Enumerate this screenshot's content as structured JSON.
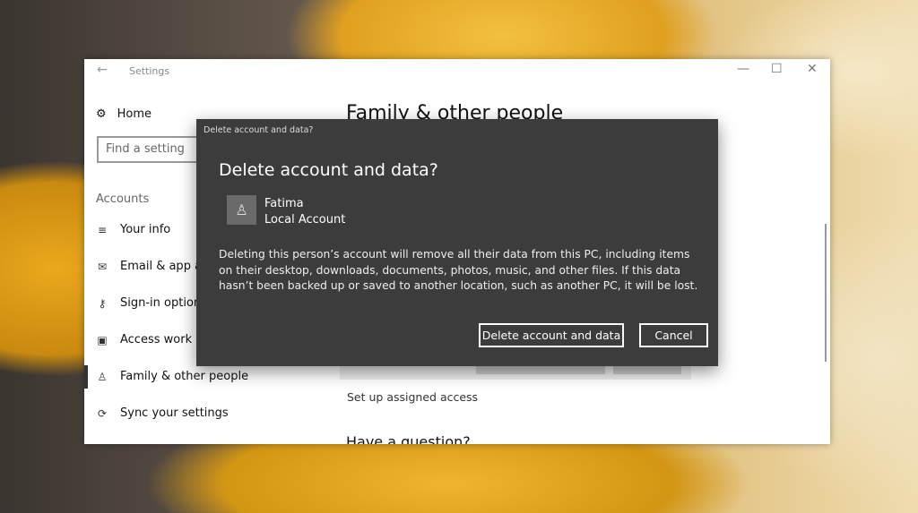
{
  "window": {
    "title": "Settings",
    "back_icon": "arrow-left-icon",
    "minimize": "—",
    "maximize": "☐",
    "close": "✕"
  },
  "sidebar": {
    "home": "Home",
    "search_placeholder": "Find a setting",
    "category": "Accounts",
    "items": [
      {
        "label": "Your info",
        "icon": "≡"
      },
      {
        "label": "Email & app accounts",
        "icon": "✉"
      },
      {
        "label": "Sign-in options",
        "icon": "⚷"
      },
      {
        "label": "Access work or school",
        "icon": "▣"
      },
      {
        "label": "Family & other people",
        "icon": "♙"
      },
      {
        "label": "Sync your settings",
        "icon": "⟳"
      }
    ],
    "selected": "Family & other people"
  },
  "main": {
    "title": "Family & other people",
    "setup_link": "Set up assigned access",
    "question": "Have a question?"
  },
  "dialog": {
    "titlebar": "Delete account and data?",
    "heading": "Delete account and data?",
    "user_name": "Fatima",
    "user_type": "Local Account",
    "body": "Deleting this person’s account will remove all their data from this PC, including items on their desktop, downloads, documents, photos, music, and other files. If this data hasn’t been backed up or saved to another location, such as another PC, it will be lost.",
    "confirm": "Delete account and data",
    "cancel": "Cancel"
  }
}
